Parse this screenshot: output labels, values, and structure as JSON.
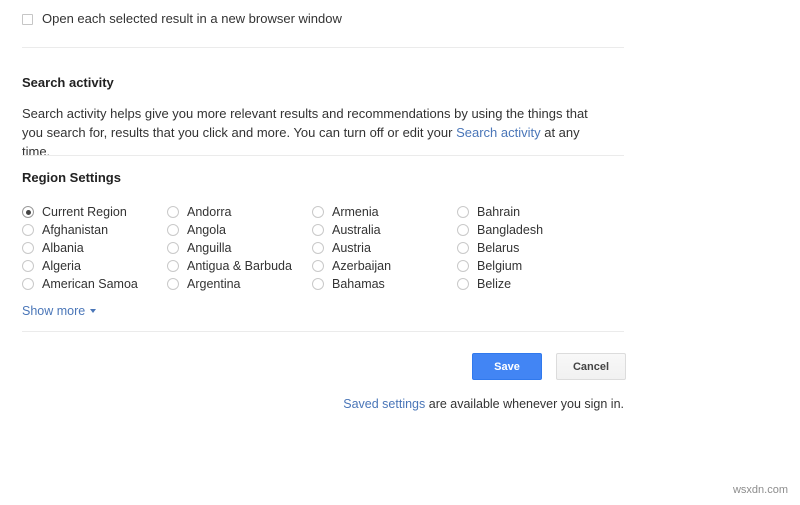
{
  "colors": {
    "accent_blue": "#4285f4",
    "link_blue": "#4a76b8",
    "divider": "#ebebeb",
    "text": "#333333",
    "cancel_bg": "#f5f5f5"
  },
  "browser_option": {
    "label": "Open each selected result in a new browser window",
    "checked": false
  },
  "search_activity": {
    "heading": "Search activity",
    "paragraph_part1": "Search activity helps give you more relevant results and recommendations by using the things that you search for, results that you click and more. You can turn off or edit your ",
    "link_label": "Search activity",
    "paragraph_part2": " at any time."
  },
  "region_settings": {
    "heading": "Region Settings",
    "selected": "Current Region",
    "options": [
      "Current Region",
      "Afghanistan",
      "Albania",
      "Algeria",
      "American Samoa",
      "Andorra",
      "Angola",
      "Anguilla",
      "Antigua & Barbuda",
      "Argentina",
      "Armenia",
      "Australia",
      "Austria",
      "Azerbaijan",
      "Bahamas",
      "Bahrain",
      "Bangladesh",
      "Belarus",
      "Belgium",
      "Belize"
    ],
    "show_more_label": "Show more",
    "show_more_icon": "caret-down-icon"
  },
  "actions": {
    "save_label": "Save",
    "cancel_label": "Cancel"
  },
  "footer": {
    "link_label": "Saved settings",
    "text": " are available whenever you sign in."
  },
  "watermark": {
    "text": "wsxdn.com"
  }
}
